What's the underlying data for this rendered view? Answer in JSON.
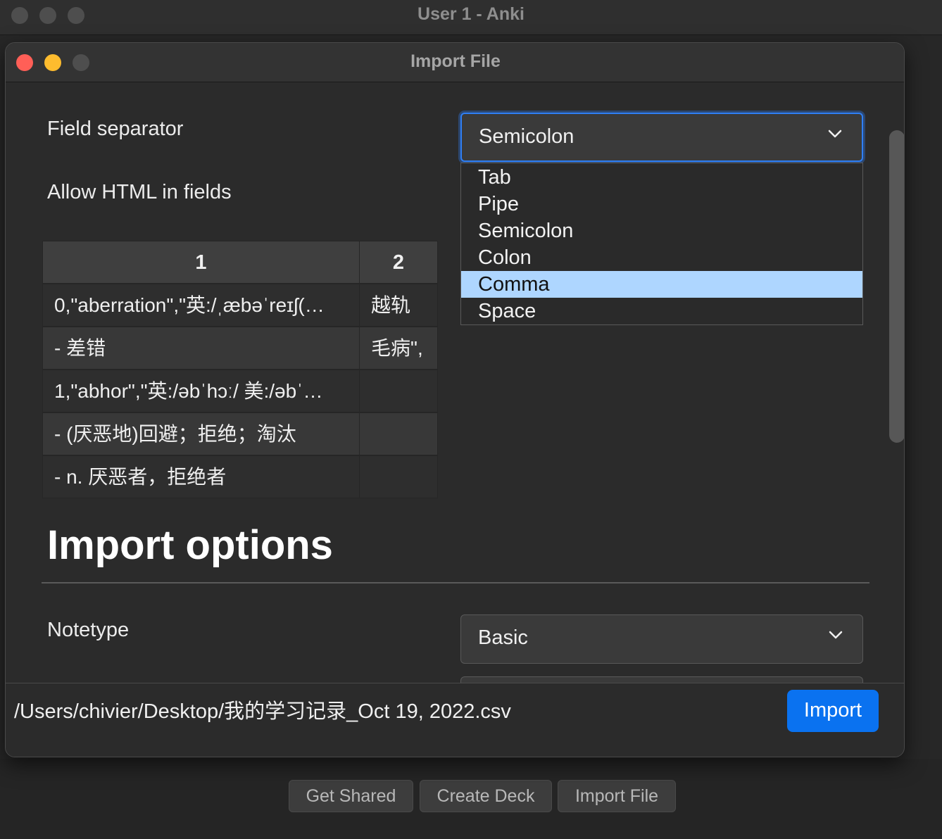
{
  "main_window": {
    "title": "User 1 - Anki",
    "buttons": [
      {
        "label": "Get Shared"
      },
      {
        "label": "Create Deck"
      },
      {
        "label": "Import File"
      }
    ]
  },
  "dialog": {
    "title": "Import File",
    "field_separator": {
      "label": "Field separator",
      "selected": "Semicolon",
      "options": [
        "Tab",
        "Pipe",
        "Semicolon",
        "Colon",
        "Comma",
        "Space"
      ],
      "highlighted": "Comma"
    },
    "allow_html": {
      "label": "Allow HTML in fields"
    },
    "preview_table": {
      "headers": [
        "1",
        "2"
      ],
      "rows": [
        [
          "0,\"aberration\",\"英:/ˌæbəˈreɪʃ(…",
          "越轨"
        ],
        [
          "- 差错",
          "毛病\","
        ],
        [
          "1,\"abhor\",\"英:/əbˈhɔː/ 美:/əbˈ…",
          ""
        ],
        [
          "- (厌恶地)回避；拒绝；淘汰",
          ""
        ],
        [
          "- n. 厌恶者，拒绝者",
          ""
        ]
      ]
    },
    "import_options_heading": "Import options",
    "notetype": {
      "label": "Notetype",
      "selected": "Basic"
    },
    "file_path": "/Users/chivier/Desktop/我的学习记录_Oct 19, 2022.csv",
    "import_button": "Import"
  },
  "colors": {
    "accent": "#0a72f0",
    "dropdown_highlight": "#aed6ff",
    "close": "#ff5f57",
    "minimize": "#febc2e"
  }
}
